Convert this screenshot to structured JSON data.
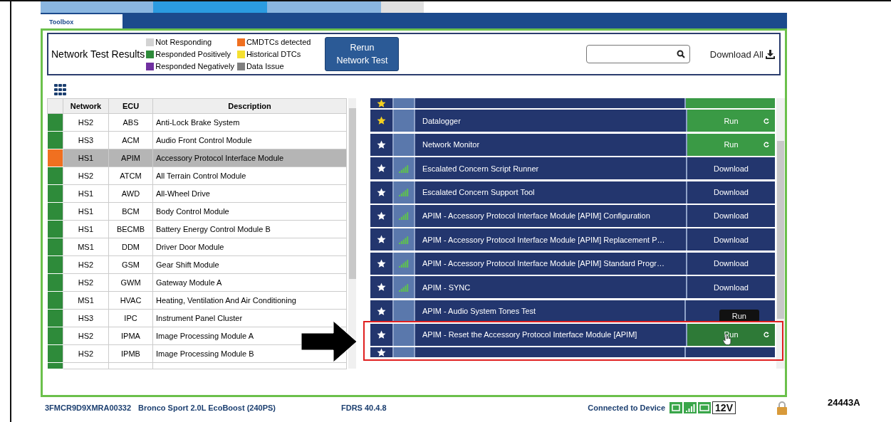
{
  "tab": {
    "label": "Toolbox",
    "selected": true
  },
  "header": {
    "title": "Network Test Results",
    "legend": [
      {
        "label": "Not Responding",
        "color": "#d3d3d3"
      },
      {
        "label": "Responded Positively",
        "color": "#2e8b3a"
      },
      {
        "label": "Responded Negatively",
        "color": "#7030a0"
      },
      {
        "label": "CMDTCs detected",
        "color": "#f07020"
      },
      {
        "label": "Historical DTCs",
        "color": "#f5e030"
      },
      {
        "label": "Data Issue",
        "color": "#808080"
      }
    ],
    "rerun_button": "Rerun Network Test",
    "download_all": "Download All"
  },
  "ecu_table": {
    "columns": [
      "Network",
      "ECU",
      "Description"
    ],
    "rows": [
      {
        "color": "#2e8b3a",
        "network": "HS2",
        "ecu": "ABS",
        "description": "Anti-Lock Brake System",
        "selected": false
      },
      {
        "color": "#2e8b3a",
        "network": "HS3",
        "ecu": "ACM",
        "description": "Audio Front Control Module",
        "selected": false
      },
      {
        "color": "#f07020",
        "network": "HS1",
        "ecu": "APIM",
        "description": "Accessory Protocol Interface Module",
        "selected": true
      },
      {
        "color": "#2e8b3a",
        "network": "HS2",
        "ecu": "ATCM",
        "description": "All Terrain Control Module",
        "selected": false
      },
      {
        "color": "#2e8b3a",
        "network": "HS1",
        "ecu": "AWD",
        "description": "All-Wheel Drive",
        "selected": false
      },
      {
        "color": "#2e8b3a",
        "network": "HS1",
        "ecu": "BCM",
        "description": "Body Control Module",
        "selected": false
      },
      {
        "color": "#2e8b3a",
        "network": "HS1",
        "ecu": "BECMB",
        "description": "Battery Energy Control Module B",
        "selected": false
      },
      {
        "color": "#2e8b3a",
        "network": "MS1",
        "ecu": "DDM",
        "description": "Driver Door Module",
        "selected": false
      },
      {
        "color": "#2e8b3a",
        "network": "HS2",
        "ecu": "GSM",
        "description": "Gear Shift Module",
        "selected": false
      },
      {
        "color": "#2e8b3a",
        "network": "HS2",
        "ecu": "GWM",
        "description": "Gateway Module A",
        "selected": false
      },
      {
        "color": "#2e8b3a",
        "network": "MS1",
        "ecu": "HVAC",
        "description": "Heating, Ventilation And Air Conditioning",
        "selected": false
      },
      {
        "color": "#2e8b3a",
        "network": "HS3",
        "ecu": "IPC",
        "description": "Instrument Panel Cluster",
        "selected": false
      },
      {
        "color": "#2e8b3a",
        "network": "HS2",
        "ecu": "IPMA",
        "description": "Image Processing Module A",
        "selected": false
      },
      {
        "color": "#2e8b3a",
        "network": "HS2",
        "ecu": "IPMB",
        "description": "Image Processing Module B",
        "selected": false
      },
      {
        "color": "#2e8b3a",
        "cut": true,
        "selected": false
      }
    ]
  },
  "tools": [
    {
      "cut": true,
      "favorite": true,
      "bars_icon": false,
      "kind": "run",
      "hovered": false
    },
    {
      "name": "Datalogger",
      "favorite": true,
      "bars_icon": false,
      "kind": "run",
      "action": "Run",
      "hovered": false
    },
    {
      "name": "Network Monitor",
      "favorite": false,
      "bars_icon": false,
      "kind": "run",
      "action": "Run",
      "hovered": false
    },
    {
      "name": "Escalated Concern Script Runner",
      "favorite": false,
      "bars_icon": true,
      "kind": "download",
      "action": "Download",
      "hovered": false
    },
    {
      "name": "Escalated Concern Support Tool",
      "favorite": false,
      "bars_icon": true,
      "kind": "download",
      "action": "Download",
      "hovered": false
    },
    {
      "name": "APIM - Accessory Protocol Interface Module [APIM] Configuration",
      "favorite": false,
      "bars_icon": true,
      "kind": "download",
      "action": "Download",
      "hovered": false
    },
    {
      "name": "APIM - Accessory Protocol Interface Module [APIM] Replacement P…",
      "favorite": false,
      "bars_icon": true,
      "kind": "download",
      "action": "Download",
      "hovered": false
    },
    {
      "name": "APIM - Accessory Protocol Interface Module [APIM] Standard Progr…",
      "favorite": false,
      "bars_icon": true,
      "kind": "download",
      "action": "Download",
      "hovered": false
    },
    {
      "name": "APIM - SYNC",
      "favorite": false,
      "bars_icon": true,
      "kind": "download",
      "action": "Download",
      "hovered": false
    },
    {
      "name": "APIM - Audio System Tones Test",
      "favorite": false,
      "bars_icon": false,
      "kind": "plain",
      "hovered": false
    },
    {
      "name": "APIM - Reset the Accessory Protocol Interface Module [APIM]",
      "favorite": false,
      "bars_icon": false,
      "kind": "run",
      "action": "Run",
      "hovered": true,
      "tooltip": "Run"
    },
    {
      "cut": true,
      "favorite": false,
      "bars_icon": false,
      "kind": "download",
      "hovered": false
    }
  ],
  "status_bar": {
    "vin": "3FMCR9D9XMRA00332",
    "vehicle": "Bronco Sport 2.0L EcoBoost (240PS)",
    "version": "FDRS 40.4.8",
    "connection": "Connected to Device",
    "voltage": "12V"
  },
  "figure_id": "24443A"
}
